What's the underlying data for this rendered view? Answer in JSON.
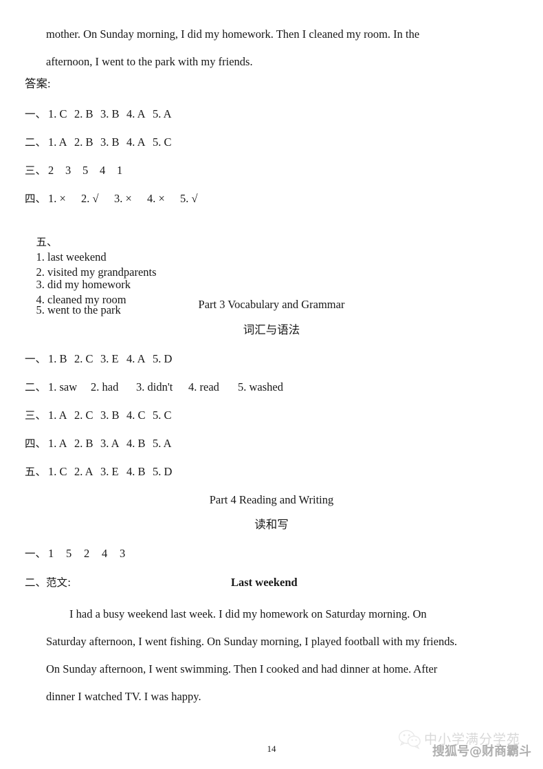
{
  "document": {
    "page_number": "14",
    "intro_paragraph": {
      "line1": "mother.  On  Sunday  morning,  I  did  my  homework.  Then  I  cleaned  my  room.  In  the",
      "line2": "afternoon, I went to the park with my friends."
    },
    "answers_label": "答案:"
  },
  "answer_block_1": {
    "rows": [
      {
        "cn": "一、",
        "items": [
          "1. C",
          "2. B",
          "3. B",
          "4. A",
          "5. A"
        ]
      },
      {
        "cn": "二、",
        "items": [
          "1. A",
          "2. B",
          "3. B",
          "4. A",
          "5. C"
        ]
      },
      {
        "cn": "三、",
        "items": [
          "2",
          "3",
          "5",
          "4",
          "1"
        ]
      },
      {
        "cn": "四、",
        "items": [
          "1. ×",
          "2. √",
          "3. ×",
          "4. ×",
          "5. √"
        ]
      }
    ],
    "row5": {
      "cn": "五、",
      "pairs": [
        {
          "left": "1. last weekend",
          "right": "2. visited my grandparents"
        },
        {
          "left": "3. did my homework",
          "right": "4. cleaned my room"
        },
        {
          "left": "5. went to the park",
          "right": ""
        }
      ]
    }
  },
  "part3": {
    "heading_en": "Part 3     Vocabulary and Grammar",
    "heading_cn": "词汇与语法",
    "rows": [
      {
        "cn": "一、",
        "items": [
          "1. B",
          "2. C",
          "3. E",
          "4. A",
          "5. D"
        ]
      },
      {
        "cn": "二、",
        "items": [
          "1. saw",
          "2. had",
          "3. didn't",
          "4. read",
          "5. washed"
        ]
      },
      {
        "cn": "三、",
        "items": [
          "1. A",
          "2. C",
          "3. B",
          "4. C",
          "5. C"
        ]
      },
      {
        "cn": "四、",
        "items": [
          "1. A",
          "2. B",
          "3. A",
          "4. B",
          "5. A"
        ]
      },
      {
        "cn": "五、",
        "items": [
          "1. C",
          "2. A",
          "3. E",
          "4. B",
          "5. D"
        ]
      }
    ]
  },
  "part4": {
    "heading_en": "Part 4    Reading and Writing",
    "heading_cn": "读和写",
    "row1": {
      "cn": "一、",
      "items": [
        "1",
        "5",
        "2",
        "4",
        "3"
      ]
    },
    "row2_label": "二、范文:",
    "essay_title": "Last weekend",
    "essay": {
      "line1": "I  had  a  busy  weekend  last  week.  I  did  my  homework  on  Saturday  morning.  On",
      "line2": "Saturday afternoon, I went fishing. On Sunday morning, I played football with my friends.",
      "line3": "On  Sunday  afternoon,  I  went  swimming.  Then  I  cooked  and  had  dinner  at  home.  After",
      "line4": "dinner I watched TV. I was happy."
    }
  },
  "watermark": {
    "line1": "中小学满分学苑",
    "line2": "搜狐号@财商霸斗",
    "icon": "wechat-icon"
  }
}
